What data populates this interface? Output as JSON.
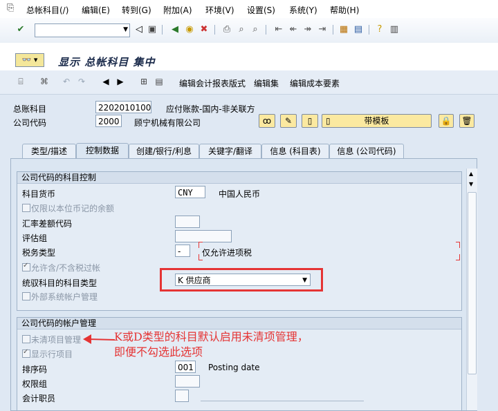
{
  "menubar": {
    "items": [
      "总帐科目(/)",
      "编辑(E)",
      "转到(G)",
      "附加(A)",
      "环境(V)",
      "设置(S)",
      "系统(Y)",
      "帮助(H)"
    ]
  },
  "screen": {
    "title": "显示 总帐科目 集中"
  },
  "app_toolbar": {
    "edit_report_layout": "编辑会计报表版式",
    "edit_set": "编辑集",
    "edit_cost_element": "编辑成本要素"
  },
  "header": {
    "gl_account_label": "总账科目",
    "gl_account_value": "2202010100",
    "gl_account_desc": "应付账款-国内-非关联方",
    "company_code_label": "公司代码",
    "company_code_value": "2000",
    "company_name": "顾宁机械有限公司",
    "template_button": "带模板"
  },
  "tabs": [
    "类型/描述",
    "控制数据",
    "创建/银行/利息",
    "关键字/翻译",
    "信息 (科目表)",
    "信息 (公司代码)"
  ],
  "group1": {
    "title": "公司代码的科目控制",
    "currency_label": "科目货币",
    "currency_value": "CNY",
    "currency_name": "中国人民币",
    "local_currency_only": "仅限以本位币记的余额",
    "exch_rate_diff_label": "汇率差额代码",
    "valuation_group_label": "评估组",
    "tax_category_label": "税务类型",
    "tax_category_value": "-",
    "tax_category_desc": "仅允许进项税",
    "posting_wo_tax": "允许含/不含税过帐",
    "recon_type_label": "统驭科目的科目类型",
    "recon_type_value": "K 供应商",
    "ext_mgmt": "外部系统帐户管理"
  },
  "group2": {
    "title": "公司代码的帐户管理",
    "open_item_mgmt": "未清项目管理",
    "line_item_display": "显示行项目",
    "sort_key_label": "排序码",
    "sort_key_value": "001",
    "sort_key_desc": "Posting date",
    "auth_group_label": "权限组",
    "accounting_clerk_label": "会计职员"
  },
  "annotation": {
    "line1": "K或D类型的科目默认启用未清项管理，",
    "line2": "即便不勾选此选项"
  },
  "colors": {
    "annotation": "#e53434",
    "panel": "#dbe6f2",
    "button": "#fbe9a0"
  }
}
